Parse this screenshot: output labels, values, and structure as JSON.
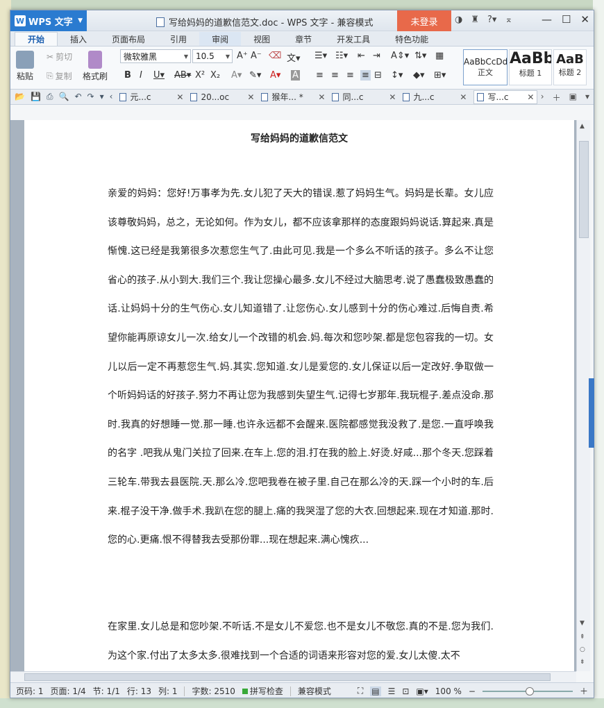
{
  "window": {
    "app_name": "WPS 文字",
    "title": "写给妈妈的道歉信范文.doc - WPS 文字 - 兼容模式",
    "login": "未登录"
  },
  "ribbon_tabs": [
    "开始",
    "插入",
    "页面布局",
    "引用",
    "审阅",
    "视图",
    "章节",
    "开发工具",
    "特色功能"
  ],
  "clipboard": {
    "paste": "粘贴",
    "cut": "剪切",
    "copy": "复制",
    "format_painter": "格式刷"
  },
  "font": {
    "name": "微软雅黑",
    "size": "10.5"
  },
  "styles": [
    {
      "sample": "AaBbCcDd",
      "label": "正文"
    },
    {
      "sample": "AaBb",
      "label": "标题 1"
    },
    {
      "sample": "AaB",
      "label": "标题 2"
    }
  ],
  "doc_tabs": [
    {
      "label": "元...c",
      "active": false
    },
    {
      "label": "20...oc",
      "active": false
    },
    {
      "label": "猴年... *",
      "active": false
    },
    {
      "label": "同...c",
      "active": false
    },
    {
      "label": "九...c",
      "active": false
    },
    {
      "label": "写...c",
      "active": true
    }
  ],
  "document": {
    "title": "写给妈妈的道歉信范文",
    "paragraph1": "亲爱的妈妈：您好!万事孝为先.女儿犯了天大的错误.惹了妈妈生气。妈妈是长辈。女儿应该尊敬妈妈，总之，无论如何。作为女儿，都不应该拿那样的态度跟妈妈说话.算起来.真是惭愧.这已经是我第很多次惹您生气了.由此可见.我是一个多么不听话的孩子。多么不让您省心的孩子.从小到大.我们三个.我让您操心最多.女儿不经过大脑思考.说了愚蠢极致愚蠢的话.让妈妈十分的生气伤心.女儿知道错了.让您伤心.女儿感到十分的伤心难过.后悔自责.希望你能再原谅女儿一次.给女儿一个改错的机会.妈.每次和您吵架.都是您包容我的一切。女儿以后一定不再惹您生气.妈.其实.您知道.女儿是爱您的.女儿保证以后一定改好.争取做一个听妈妈话的好孩子.努力不再让您为我感到失望生气.记得七岁那年.我玩棍子.差点没命.那时.我真的好想睡一觉.那一睡.也许永远都不会醒来.医院都感觉我没救了.是您.一直呼唤我的名字 .吧我从鬼门关拉了回来.在车上.您的泪.打在我的脸上.好烫.好咸...那个冬天.您踩着三轮车.带我去县医院.天.那么冷.您吧我卷在被子里.自己在那么冷的天.踩一个小时的车.后来.棍子没干净.做手术.我趴在您的腿上.痛的我哭湿了您的大衣.回想起来.现在才知道.那时.您的心.更痛.恨不得替我去受那份罪...现在想起来.满心愧疚...",
    "paragraph2": "在家里.女儿总是和您吵架.不听话.不是女儿不爱您.也不是女儿不敬您.真的不是.您为我们.为这个家.付出了太多太多.很难找到一个合适的词语来形容对您的爱.女儿太傻.太不"
  },
  "status": {
    "page_code": "页码: 1",
    "page": "页面: 1/4",
    "section": "节: 1/1",
    "row": "行: 13",
    "col": "列: 1",
    "words": "字数: 2510",
    "spell": "拼写检查",
    "mode": "兼容模式",
    "zoom": "100 %"
  }
}
